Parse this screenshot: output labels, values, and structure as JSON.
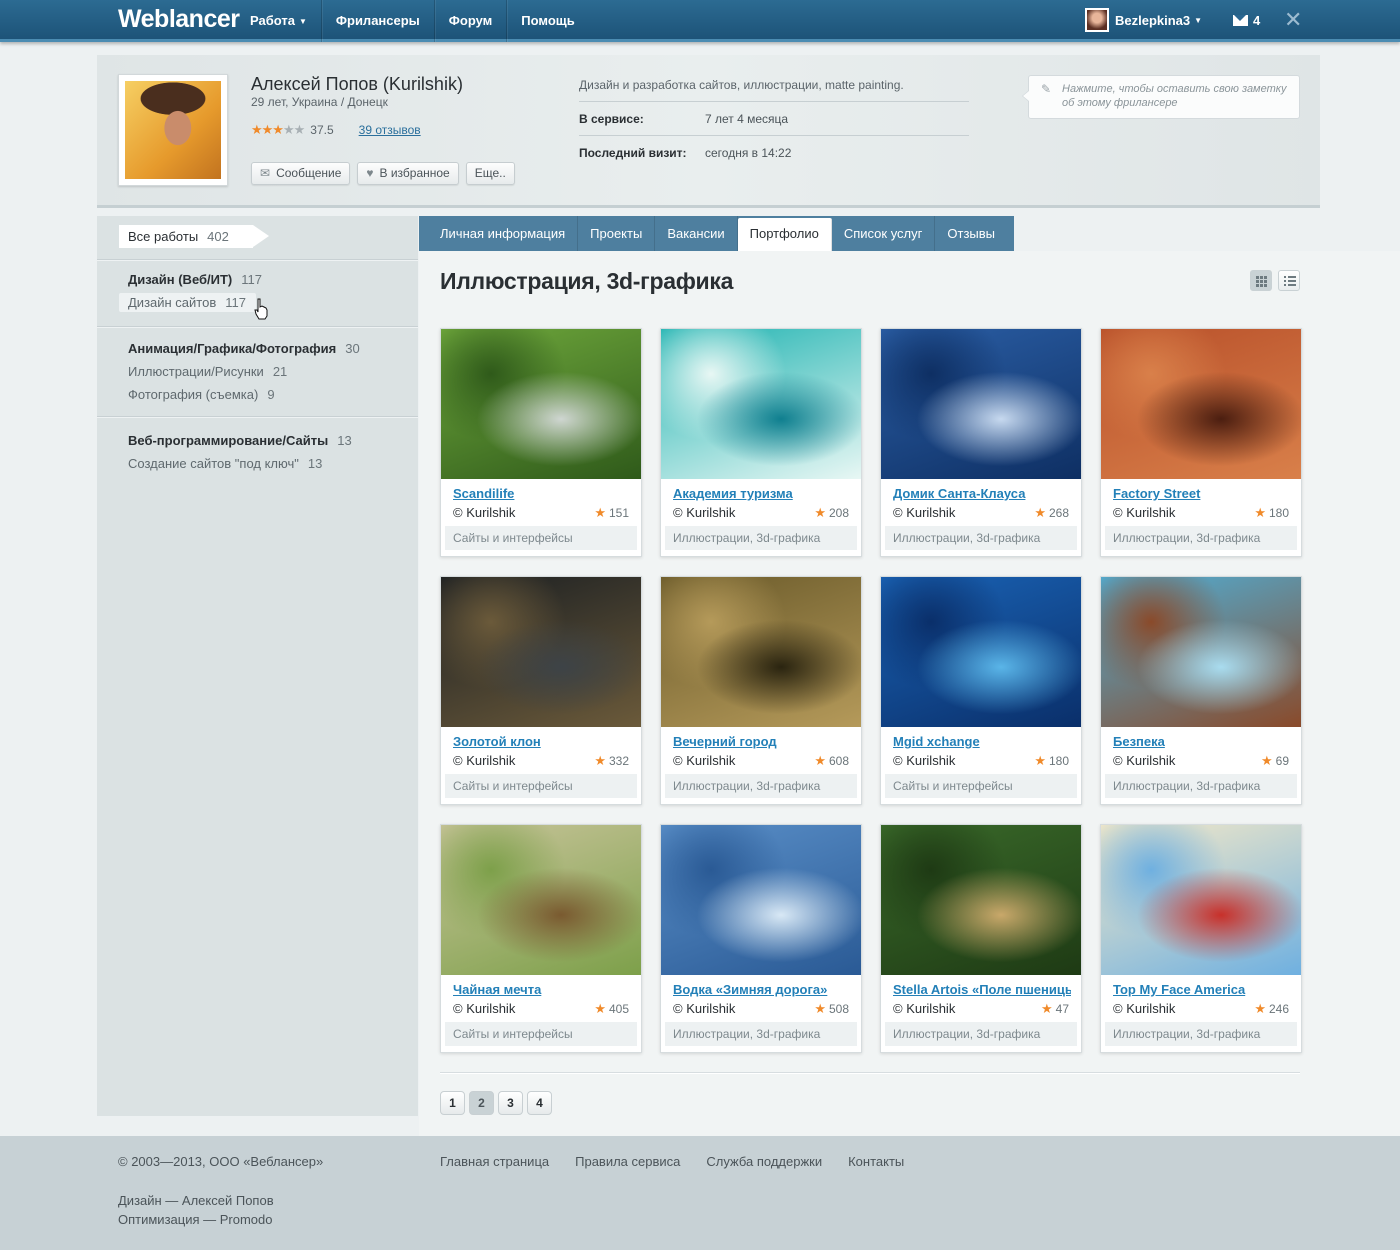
{
  "topbar": {
    "logo": "Weblancer",
    "nav": [
      "Работа",
      "Фрилансеры",
      "Форум",
      "Помощь"
    ],
    "username": "Bezlepkina3",
    "mail_count": "4",
    "colors": {
      "bar": "#1d5378",
      "accent": "#4b8cb2"
    }
  },
  "profile": {
    "name": "Алексей Попов (Kurilshik)",
    "meta": "29 лет, Украина / Донецк",
    "rating": "37.5",
    "stars_filled": 3,
    "stars_total": 5,
    "reviews": "39 отзывов",
    "buttons": {
      "message": "Сообщение",
      "favorite": "В избранное",
      "more": "Еще.."
    },
    "description": "Дизайн и разработка сайтов, иллюстрации, matte painting.",
    "service_label": "В сервисе:",
    "service_value": "7 лет 4 месяца",
    "lastvisit_label": "Последний визит:",
    "lastvisit_value": "сегодня в 14:22",
    "note_placeholder": "Нажмите, чтобы оставить свою заметку об этому фрилансере"
  },
  "sidebar": {
    "all_label": "Все работы",
    "all_count": "402",
    "groups": [
      {
        "name": "Дизайн (Веб/ИТ)",
        "count": "117",
        "subs": [
          {
            "name": "Дизайн сайтов",
            "count": "117"
          }
        ]
      },
      {
        "name": "Анимация/Графика/Фотография",
        "count": "30",
        "subs": [
          {
            "name": "Иллюстрации/Рисунки",
            "count": "21"
          },
          {
            "name": "Фотография (съемка)",
            "count": "9"
          }
        ]
      },
      {
        "name": "Веб-программирование/Сайты",
        "count": "13",
        "subs": [
          {
            "name": "Создание сайтов \"под ключ\"",
            "count": "13"
          }
        ]
      }
    ]
  },
  "tabs": [
    "Личная информация",
    "Проекты",
    "Вакансии",
    "Портфолио",
    "Список услуг",
    "Отзывы"
  ],
  "active_tab": "Портфолио",
  "heading": "Иллюстрация, 3d-графика",
  "cards": [
    {
      "title": "Scandilife",
      "author": "© Kurilshik",
      "views": "151",
      "category": "Сайты и интерфейсы",
      "palette": [
        "#6fa83c",
        "#cfd6d1",
        "#2f5a1a"
      ]
    },
    {
      "title": "Академия туризма",
      "author": "© Kurilshik",
      "views": "208",
      "category": "Иллюстрации, 3d-графика",
      "palette": [
        "#1fb3b1",
        "#0f7f8f",
        "#e8f7f4"
      ]
    },
    {
      "title": "Домик Санта-Клауса",
      "author": "© Kurilshik",
      "views": "268",
      "category": "Иллюстрации, 3d-графика",
      "palette": [
        "#2b5fa6",
        "#c7d9ef",
        "#0e2f63"
      ]
    },
    {
      "title": "Factory Street",
      "author": "© Kurilshik",
      "views": "180",
      "category": "Иллюстрации, 3d-графика",
      "palette": [
        "#b8502a",
        "#4b1e10",
        "#d9804a"
      ]
    },
    {
      "title": "Золотой клон",
      "author": "© Kurilshik",
      "views": "332",
      "category": "Сайты и интерфейсы",
      "palette": [
        "#1b1f22",
        "#3d4347",
        "#6b5a3a"
      ]
    },
    {
      "title": "Вечерний город",
      "author": "© Kurilshik",
      "views": "608",
      "category": "Иллюстрации, 3d-графика",
      "palette": [
        "#6a5a2a",
        "#2a2410",
        "#b59a5a"
      ]
    },
    {
      "title": "Mgid xchange",
      "author": "© Kurilshik",
      "views": "180",
      "category": "Сайты и интерфейсы",
      "palette": [
        "#1a63b5",
        "#5ab5e8",
        "#0a2f6a"
      ]
    },
    {
      "title": "Безпека",
      "author": "© Kurilshik",
      "views": "69",
      "category": "Иллюстрации, 3d-графика",
      "palette": [
        "#4fb0d8",
        "#a9dcef",
        "#8a4a2a"
      ]
    },
    {
      "title": "Чайная мечта",
      "author": "© Kurilshik",
      "views": "405",
      "category": "Сайты и интерфейсы",
      "palette": [
        "#c8c49a",
        "#7a5a30",
        "#7da04a"
      ]
    },
    {
      "title": "Водка «Зимняя дорога»",
      "author": "© Kurilshik",
      "views": "508",
      "category": "Иллюстрации, 3d-графика",
      "palette": [
        "#5a8fc8",
        "#d8e8f5",
        "#2a5a95"
      ]
    },
    {
      "title": "Stella Artois «Поле пшеницы»",
      "author": "© Kurilshik",
      "views": "47",
      "category": "Иллюстрации, 3d-графика",
      "palette": [
        "#3a6a2a",
        "#c9a86a",
        "#1e3a14"
      ]
    },
    {
      "title": "Top My Face America",
      "author": "© Kurilshik",
      "views": "246",
      "category": "Иллюстрации, 3d-графика",
      "palette": [
        "#f5e9c8",
        "#c8302a",
        "#6fb0e0"
      ]
    }
  ],
  "pagination": {
    "pages": [
      "1",
      "2",
      "3",
      "4"
    ],
    "active": "2"
  },
  "footer": {
    "copyright": "© 2003—2013, ООО «Веблансер»",
    "credits": [
      "Дизайн — Алексей Попов",
      "Оптимизация — Promodo"
    ],
    "links": [
      "Главная страница",
      "Правила сервиса",
      "Служба поддержки",
      "Контакты"
    ]
  }
}
